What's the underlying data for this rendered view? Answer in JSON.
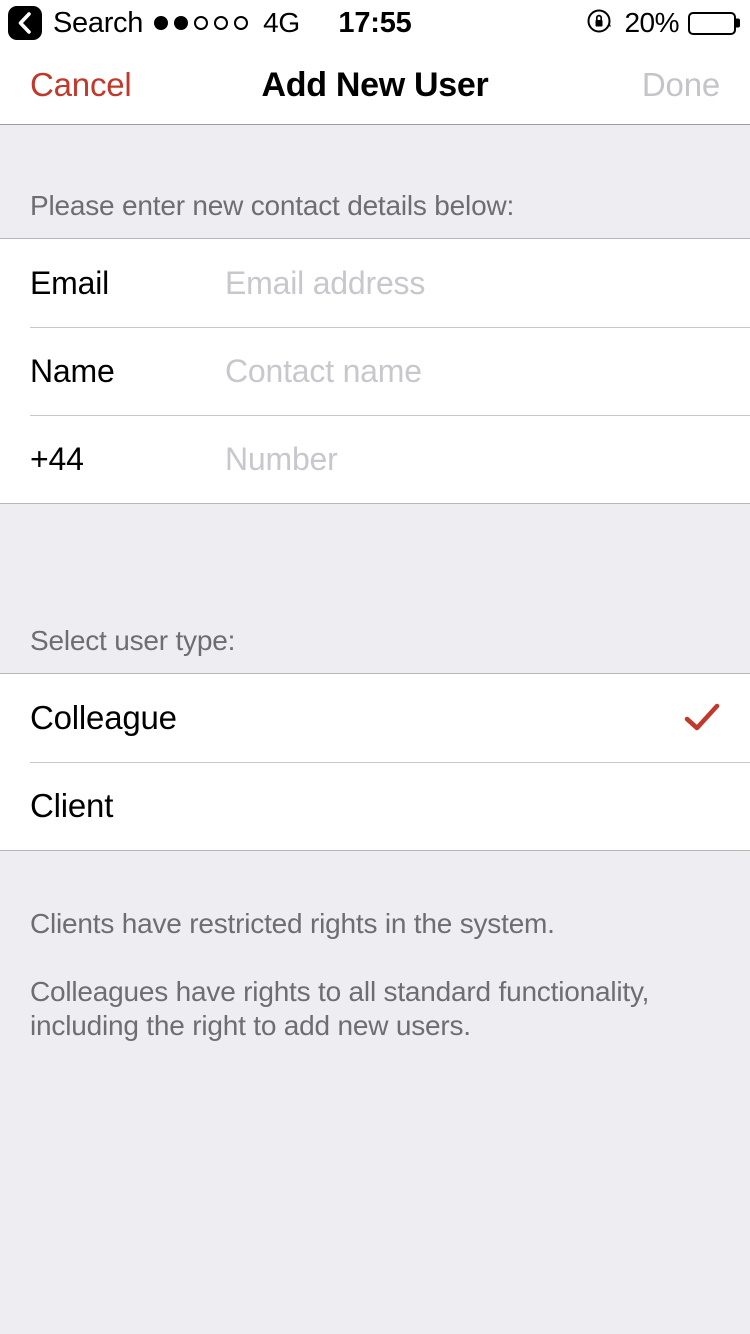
{
  "status_bar": {
    "back_icon": "back-chevron-icon",
    "carrier": "Search",
    "signal_dots_filled": 2,
    "signal_dots_total": 5,
    "network": "4G",
    "time": "17:55",
    "rotation_lock_icon": "rotation-lock-icon",
    "battery_percent_label": "20%",
    "battery_level": 20,
    "battery_color": "#e8402a"
  },
  "nav_bar": {
    "cancel_label": "Cancel",
    "title": "Add New User",
    "done_label": "Done",
    "cancel_color": "#c0392b",
    "done_color": "#c5c5c9"
  },
  "contact_section": {
    "header": "Please enter new contact details below:",
    "fields": [
      {
        "label": "Email",
        "placeholder": "Email address",
        "value": ""
      },
      {
        "label": "Name",
        "placeholder": "Contact name",
        "value": ""
      },
      {
        "label": "+44",
        "placeholder": "Number",
        "value": ""
      }
    ]
  },
  "user_type_section": {
    "header": "Select user type:",
    "selected": "Colleague",
    "check_icon": "checkmark-icon",
    "check_color": "#c0392b",
    "options": [
      {
        "label": "Colleague",
        "selected": true
      },
      {
        "label": "Client",
        "selected": false
      }
    ],
    "footer_paragraphs": [
      "Clients have restricted rights in the system.",
      "Colleagues have rights to all standard functionality, including the right to add new users."
    ]
  }
}
